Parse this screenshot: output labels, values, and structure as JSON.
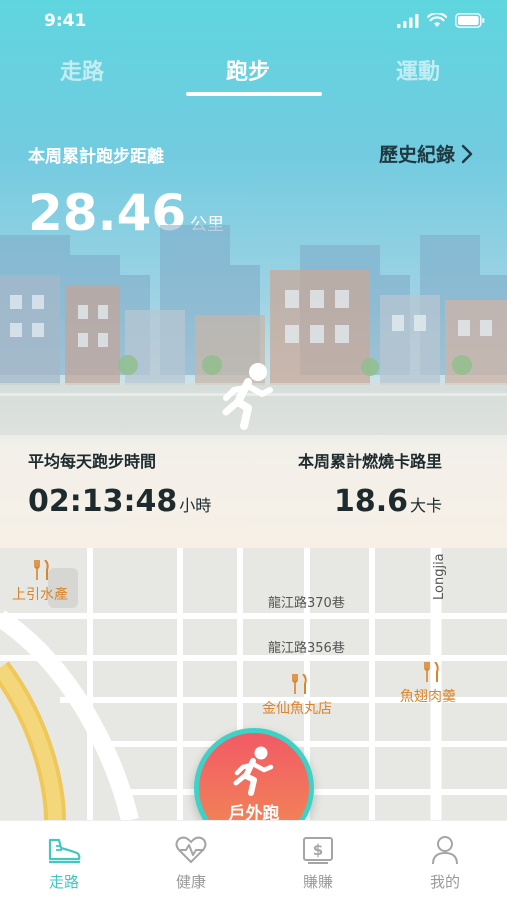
{
  "status_bar": {
    "time": "9:41"
  },
  "tabs": [
    {
      "label": "走路"
    },
    {
      "label": "跑步"
    },
    {
      "label": "運動"
    }
  ],
  "summary": {
    "week_distance_label": "本周累計跑步距離",
    "history_label": "歷史紀錄",
    "distance_value": "28.46",
    "distance_unit": "公里",
    "avg_time_label": "平均每天跑步時間",
    "avg_time_value": "02:13:48",
    "avg_time_unit": "小時",
    "calorie_label": "本周累計燃燒卡路里",
    "calorie_value": "18.6",
    "calorie_unit": "大卡"
  },
  "map": {
    "labels": {
      "road1": "龍江路370巷",
      "road2": "龍江路356巷",
      "street": "Longjia",
      "poi1": "上引水產",
      "poi2": "金仙魚丸店",
      "poi3": "魚翅肉羹"
    }
  },
  "cta": {
    "label": "戶外跑"
  },
  "bottom_nav": [
    {
      "label": "走路",
      "icon": "sneaker-icon",
      "active": true
    },
    {
      "label": "健康",
      "icon": "heart-pulse-icon",
      "active": false
    },
    {
      "label": "賺賺",
      "icon": "dollar-icon",
      "active": false
    },
    {
      "label": "我的",
      "icon": "user-icon",
      "active": false
    }
  ],
  "colors": {
    "accent": "#3fc9c2",
    "cta": "#f25a66"
  }
}
